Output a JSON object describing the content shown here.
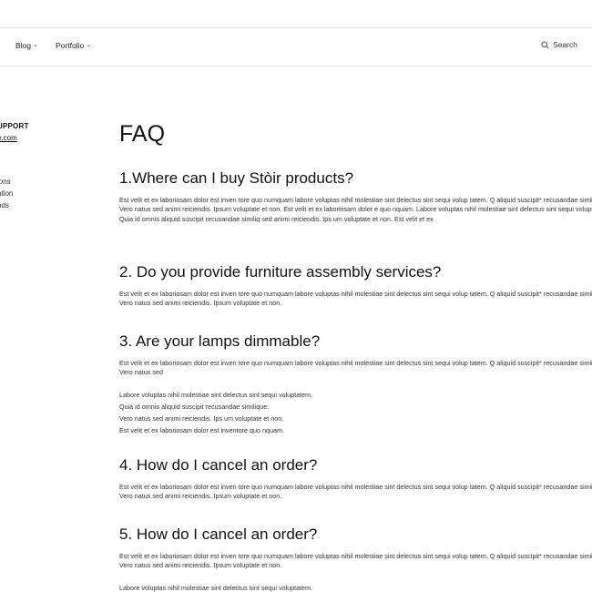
{
  "nav": {
    "items": [
      {
        "label": "Blog"
      },
      {
        "label": "Portfolio"
      }
    ],
    "search_label": "Search"
  },
  "sidebar": {
    "support_title": "UPPORT",
    "support_email": "e.com",
    "links": [
      "ions",
      "ation",
      "nds"
    ]
  },
  "main": {
    "title": "FAQ",
    "faqs": [
      {
        "question": "1.Where can I buy Stòir products?",
        "answer": "Est velit et ex laboriosam dolor est inven tore quo numquam labore voluptas nihil molestiae sint delectus sint sequi volup tatem. Q aliquid suscipit* recusandae similique. Vero natus sed animi reiciendis. Ipsum voluptate et non. Est velit et ex laboriosam dolor e quo nquam. Labore voluptas nihil molestiae sint delectus sint sequi voluptatem. Quia id omnis aliquid suscipit recusandae similiq sed animi reiciendis. Ips um voluptate et non. Est velit et ex"
      },
      {
        "question": "2. Do you provide furniture assembly services?",
        "answer": "Est velit et ex laboriosam dolor est inven tore quo numquam labore voluptas nihil molestiae sint delectus sint sequi volup tatem. Q aliquid suscipit* recusandae similique. Vero natus sed animi reiciendis. Ipsum voluptate et non."
      },
      {
        "question": "3. Are your lamps dimmable?",
        "answer": "Est velit et ex laboriosam dolor est inven tore quo numquam labore voluptas nihil molestiae sint delectus sint sequi volup tatem. Q aliquid suscipit* recusandae similique. Vero natus sed",
        "extra_lines": [
          " Labore voluptas nihil molestiae sint delectus sint sequi voluptatem.",
          "Quia id omnis aliquid suscipit recusandae similique.",
          "Vero natus sed animi reiciendis. Ips um voluptate et non.",
          "Est velit et ex laboriosam dolor est inventore quo nquam."
        ]
      },
      {
        "question": "4. How do I cancel an order?",
        "answer": "Est velit et ex laboriosam dolor est inven tore quo numquam labore voluptas nihil molestiae sint delectus sint sequi volup tatem. Q aliquid suscipit* recusandae similique. Vero natus sed animi reiciendis. Ipsum voluptate et non."
      },
      {
        "question": "5. How do I cancel an order?",
        "answer": "Est velit et ex laboriosam dolor est inven tore quo numquam labore voluptas nihil molestiae sint delectus sint sequi volup tatem. Q aliquid suscipit* recusandae similique. Vero natus sed animi reiciendis. Ipsum voluptate et non.",
        "extra_lines": [
          " Labore voluptas nihil molestiae sint delectus sint sequi voluptatem."
        ]
      }
    ]
  }
}
